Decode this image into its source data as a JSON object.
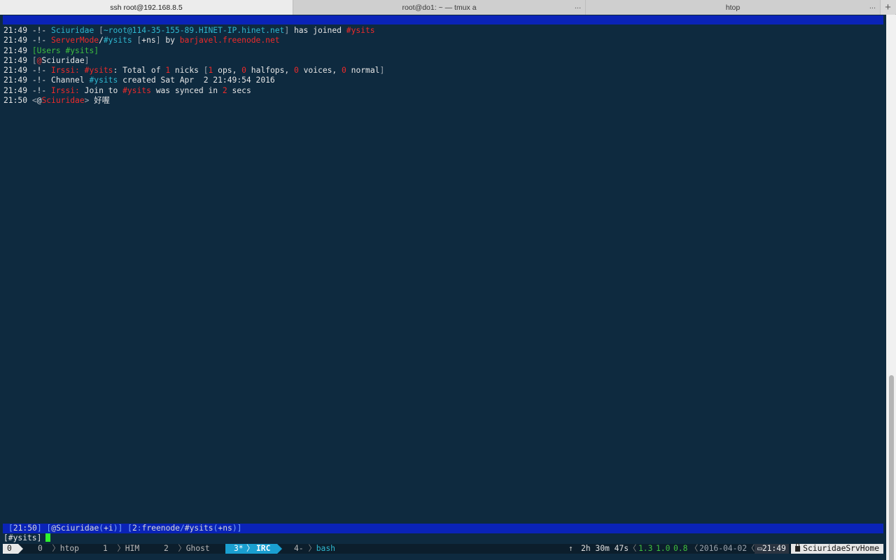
{
  "tabs": [
    {
      "label": "ssh root@192.168.8.5",
      "active": true
    },
    {
      "label": "root@do1: ~ — tmux a",
      "active": false
    },
    {
      "label": "htop",
      "active": false
    }
  ],
  "tab_ellipsis": "...",
  "tab_add": "+",
  "log": [
    {
      "time": "21:49",
      "prefix": "-!-",
      "parts": [
        {
          "t": "Sciuridae",
          "c": "c"
        },
        {
          "t": " [",
          "c": "dim"
        },
        {
          "t": "~root@114-35-155-89.HINET-IP.hinet.net",
          "c": "c"
        },
        {
          "t": "]",
          "c": "dim"
        },
        {
          "t": " has joined ",
          "c": "w"
        },
        {
          "t": "#ysits",
          "c": "r"
        }
      ]
    },
    {
      "time": "21:49",
      "prefix": "-!-",
      "parts": [
        {
          "t": "ServerMode",
          "c": "r"
        },
        {
          "t": "/",
          "c": "w"
        },
        {
          "t": "#ysits",
          "c": "c"
        },
        {
          "t": " [",
          "c": "dim"
        },
        {
          "t": "+ns",
          "c": "w"
        },
        {
          "t": "]",
          "c": "dim"
        },
        {
          "t": " by ",
          "c": "w"
        },
        {
          "t": "barjavel.freenode.net",
          "c": "r"
        }
      ]
    },
    {
      "time": "21:49",
      "prefix": "",
      "parts": [
        {
          "t": "[",
          "c": "g"
        },
        {
          "t": "Users ",
          "c": "g"
        },
        {
          "t": "#ysits",
          "c": "g"
        },
        {
          "t": "]",
          "c": "g"
        }
      ]
    },
    {
      "time": "21:49",
      "prefix": "",
      "parts": [
        {
          "t": "[",
          "c": "dim"
        },
        {
          "t": "@",
          "c": "r"
        },
        {
          "t": "Sciuridae",
          "c": "w"
        },
        {
          "t": "]",
          "c": "dim"
        }
      ]
    },
    {
      "time": "21:49",
      "prefix": "-!-",
      "parts": [
        {
          "t": "Irssi:",
          "c": "r"
        },
        {
          "t": " ",
          "c": "w"
        },
        {
          "t": "#ysits",
          "c": "r"
        },
        {
          "t": ": Total of ",
          "c": "w"
        },
        {
          "t": "1",
          "c": "r"
        },
        {
          "t": " nicks ",
          "c": "w"
        },
        {
          "t": "[",
          "c": "dim"
        },
        {
          "t": "1",
          "c": "r"
        },
        {
          "t": " ops, ",
          "c": "w"
        },
        {
          "t": "0",
          "c": "r"
        },
        {
          "t": " halfops, ",
          "c": "w"
        },
        {
          "t": "0",
          "c": "r"
        },
        {
          "t": " voices, ",
          "c": "w"
        },
        {
          "t": "0",
          "c": "r"
        },
        {
          "t": " normal",
          "c": "w"
        },
        {
          "t": "]",
          "c": "dim"
        }
      ]
    },
    {
      "time": "21:49",
      "prefix": "-!-",
      "parts": [
        {
          "t": "Channel ",
          "c": "w"
        },
        {
          "t": "#ysits",
          "c": "c"
        },
        {
          "t": " created Sat Apr  2 21:49:54 2016",
          "c": "w"
        }
      ]
    },
    {
      "time": "21:49",
      "prefix": "-!-",
      "parts": [
        {
          "t": "Irssi:",
          "c": "r"
        },
        {
          "t": " Join to ",
          "c": "w"
        },
        {
          "t": "#ysits",
          "c": "r"
        },
        {
          "t": " was synced in ",
          "c": "w"
        },
        {
          "t": "2",
          "c": "r"
        },
        {
          "t": " secs",
          "c": "w"
        }
      ]
    },
    {
      "time": "21:50",
      "prefix": "",
      "parts": [
        {
          "t": "<",
          "c": "dim"
        },
        {
          "t": "@",
          "c": "w"
        },
        {
          "t": "Sciuridae",
          "c": "r"
        },
        {
          "t": ">",
          "c": "dim"
        },
        {
          "t": " 好喔",
          "c": "w"
        }
      ]
    }
  ],
  "statusbar": {
    "time": "21:50",
    "nick": "@Sciuridae",
    "nick_mode": "+i",
    "window_num": "2",
    "network": "freenode",
    "channel": "#ysits",
    "channel_mode": "+ns"
  },
  "input": {
    "prompt": "[#ysits]",
    "value": ""
  },
  "tmux": {
    "session": "0",
    "windows": [
      {
        "index": "0",
        "name": "htop"
      },
      {
        "index": "1",
        "name": "HIM"
      },
      {
        "index": "2",
        "name": "Ghost"
      },
      {
        "index": "3*",
        "name": "IRC",
        "active": true
      },
      {
        "index": "4-",
        "name": "bash"
      }
    ],
    "uptime_arrow": "↑",
    "uptime": "2h 30m 47s",
    "load": [
      "1.3",
      "1.0",
      "0.8"
    ],
    "date": "2016-04-02",
    "time": "21:49",
    "hostname": "SciuridaeSrvHome"
  }
}
